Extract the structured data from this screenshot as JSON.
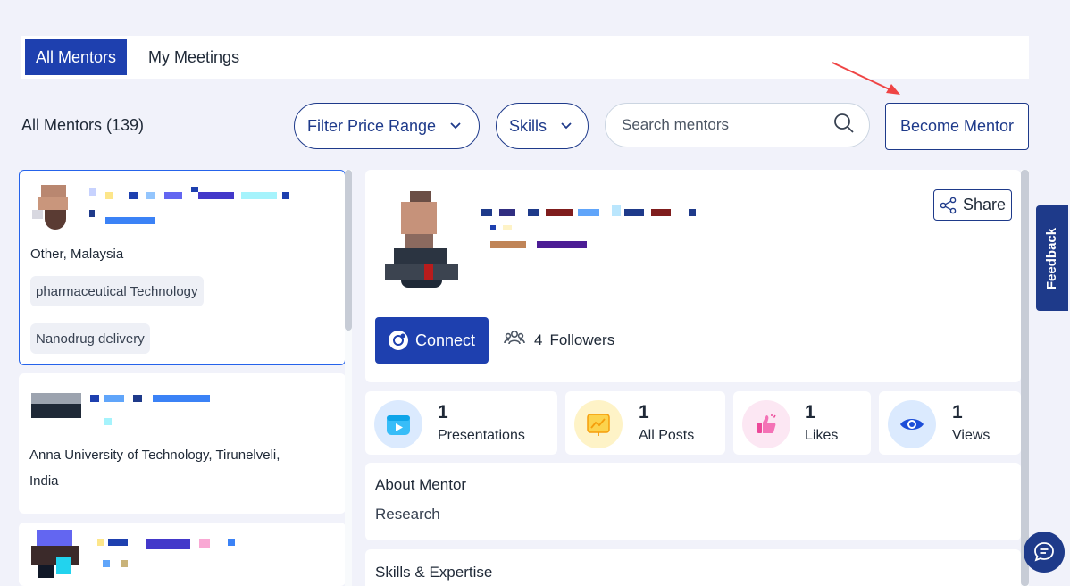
{
  "tabs": [
    {
      "label": "All Mentors",
      "active": true
    },
    {
      "label": "My Meetings",
      "active": false
    }
  ],
  "toolbar": {
    "title": "All Mentors (139)",
    "filter_price_label": "Filter Price Range",
    "skills_label": "Skills",
    "search_placeholder": "Search mentors",
    "become_mentor_label": "Become Mentor"
  },
  "mentor_list": [
    {
      "location": "Other, Malaysia",
      "tags": [
        "pharmaceutical Technology",
        "Nanodrug delivery"
      ],
      "selected": true
    },
    {
      "location_line1": "Anna University of Technology, Tirunelveli,",
      "location_line2": "India",
      "tags": [],
      "selected": false
    },
    {
      "location": "",
      "tags": [],
      "selected": false
    }
  ],
  "profile": {
    "share_label": "Share",
    "connect_label": "Connect",
    "followers_count": "4",
    "followers_label": "Followers",
    "stats": [
      {
        "value": "1",
        "label": "Presentations",
        "icon": "presentation-icon",
        "color": "#dbeafe"
      },
      {
        "value": "1",
        "label": "All Posts",
        "icon": "posts-icon",
        "color": "#fef3c7"
      },
      {
        "value": "1",
        "label": "Likes",
        "icon": "thumbs-up-icon",
        "color": "#fce7f3"
      },
      {
        "value": "1",
        "label": "Views",
        "icon": "eye-icon",
        "color": "#dbeafe"
      }
    ],
    "about_heading": "About Mentor",
    "about_text": "Research",
    "skills_heading": "Skills & Expertise"
  },
  "side": {
    "feedback_label": "Feedback"
  },
  "colors": {
    "primary": "#1e40af",
    "background": "#f1f2fa",
    "accent_arrow": "#ef4444"
  }
}
